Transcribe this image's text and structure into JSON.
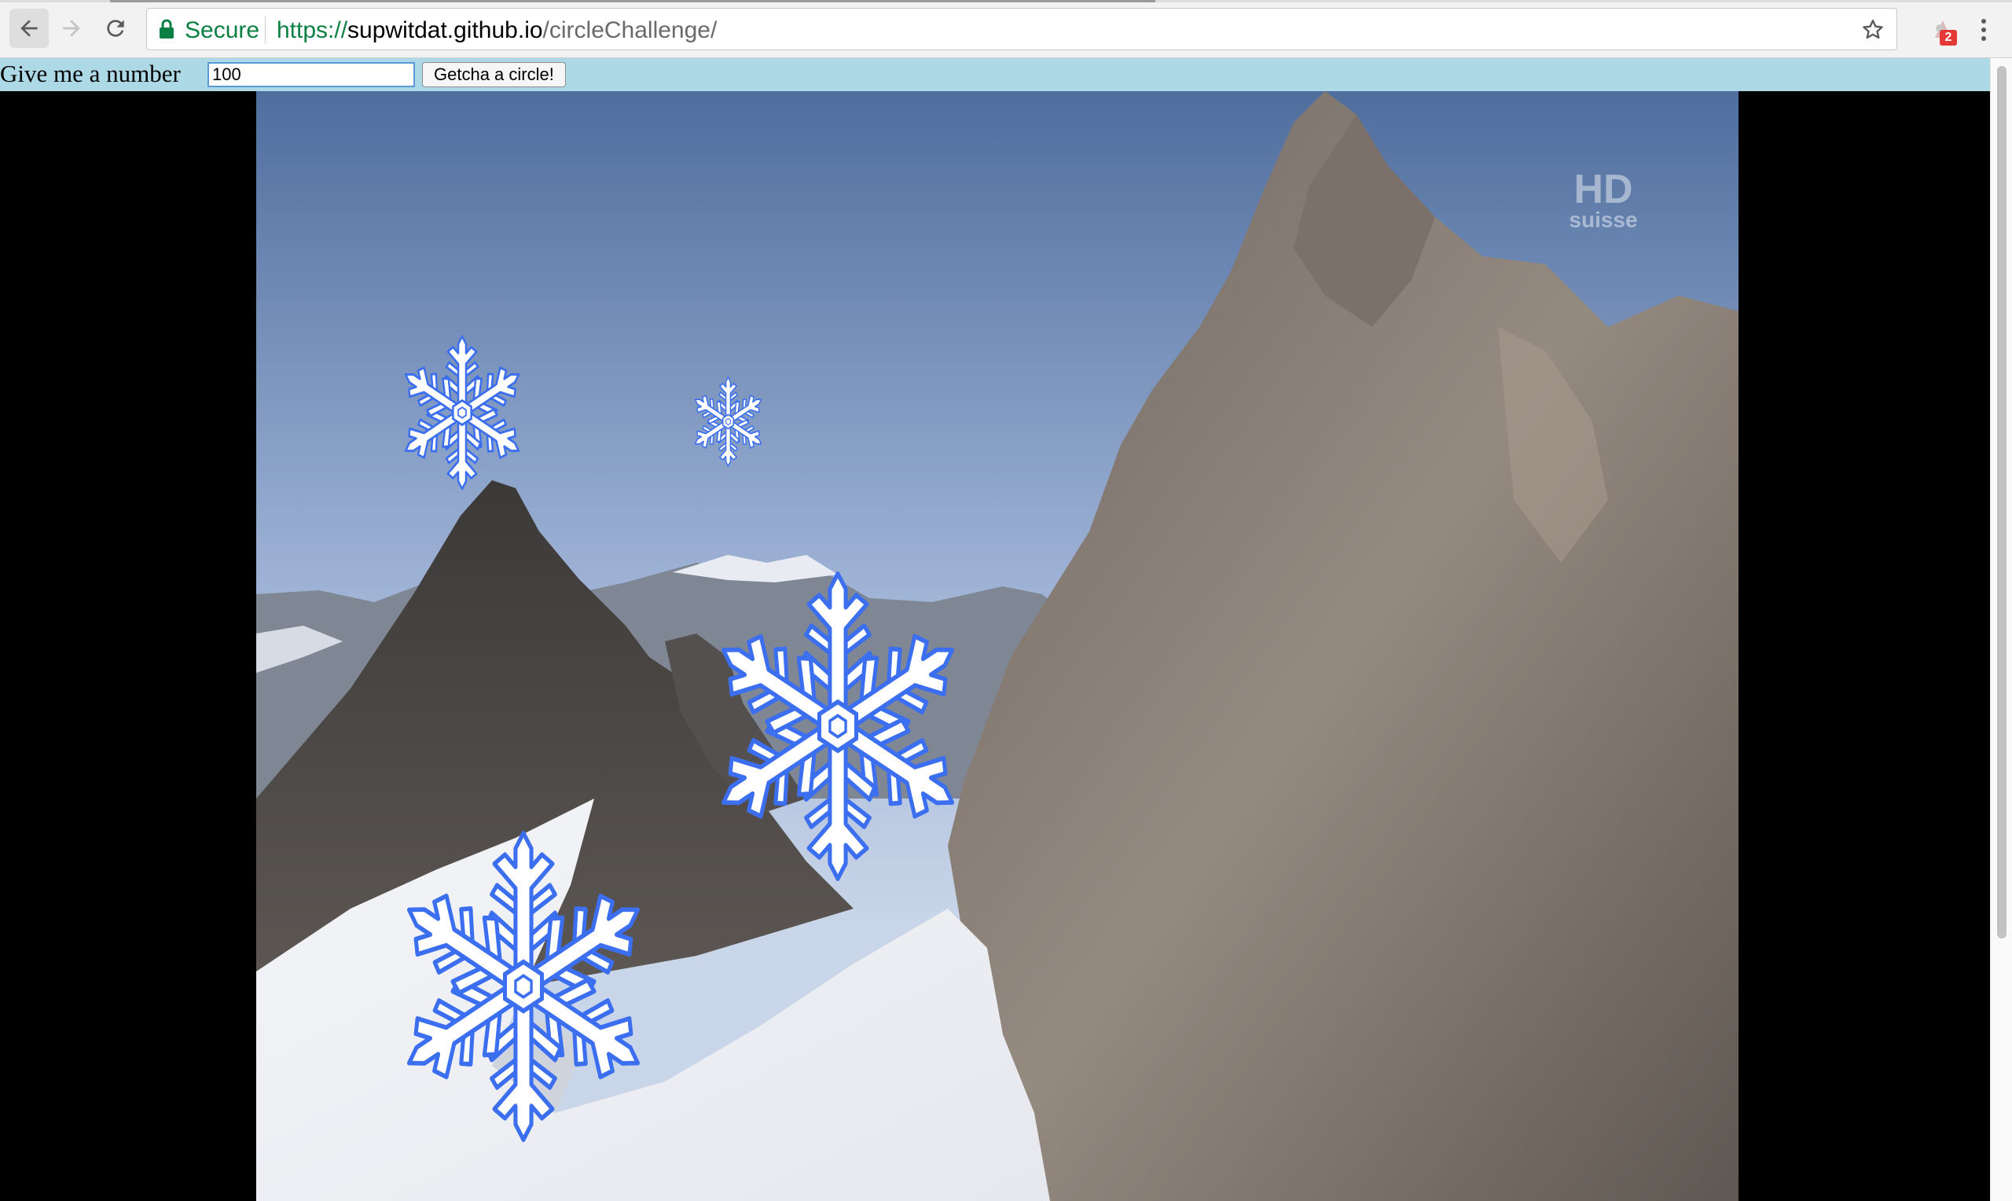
{
  "browser": {
    "secure_label": "Secure",
    "url_scheme": "https://",
    "url_host": "supwitdat.github.io",
    "url_path": "/circleChallenge/",
    "extension_badge": "2"
  },
  "form": {
    "label": "Give me a number",
    "input_value": "100",
    "button_label": "Getcha a circle!"
  },
  "watermark": {
    "line1": "HD",
    "line2": "suisse"
  },
  "colors": {
    "form_bar": "#add8e6",
    "snowflake_fill": "#ffffff",
    "snowflake_stroke": "#3b6ff0",
    "secure_green": "#0b8043"
  },
  "icons": [
    "back-arrow-icon",
    "forward-arrow-icon",
    "reload-icon",
    "lock-icon",
    "star-icon",
    "extension-icon",
    "menu-icon",
    "snowflake-icon"
  ]
}
